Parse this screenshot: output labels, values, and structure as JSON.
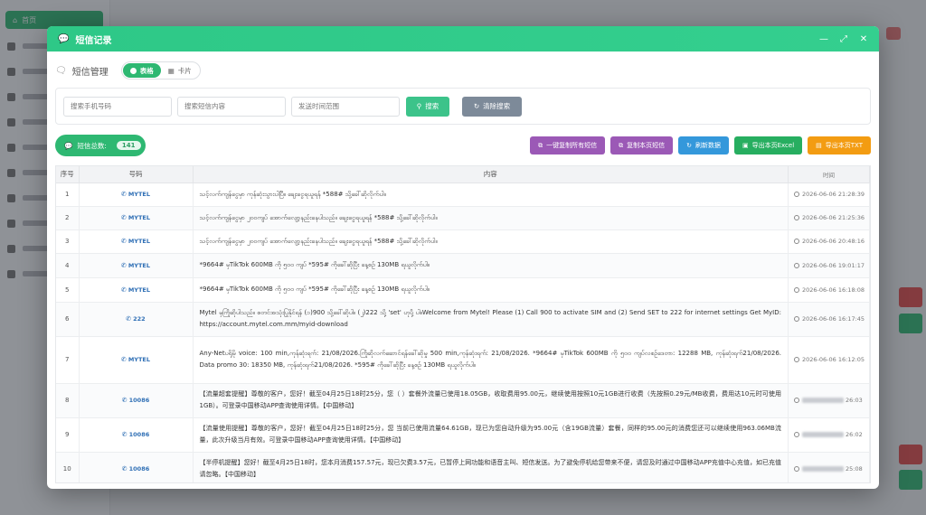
{
  "background": {
    "home_label": "首页"
  },
  "modal": {
    "title": "短信记录",
    "controls": [
      "—",
      "⤢",
      "✕"
    ],
    "subtitle": "短信管理",
    "view_table": "表格",
    "view_card": "卡片"
  },
  "search": {
    "phone_placeholder": "搜索手机号码",
    "content_placeholder": "搜索短信内容",
    "time_placeholder": "发送时间范围",
    "search_label": "搜索",
    "clear_label": "清除搜索"
  },
  "toolbar": {
    "total_label": "短信总数:",
    "total_count": "141",
    "copy_all_label": "一键复制所有短信",
    "copy_page_label": "复制本页短信",
    "refresh_label": "刷新数据",
    "export_excel_label": "导出本页Excel",
    "export_txt_label": "导出本页TXT"
  },
  "table": {
    "headers": [
      "序号",
      "号码",
      "内容",
      "时间"
    ],
    "rows": [
      {
        "idx": "1",
        "number": "MYTEL",
        "content": "သင့်လက်ကျန်ငွေမှာ ကုန်ဆုံးသွားပါပြီ။ ချေးငွေရယူရန် *588# သို့ခေါ်ဆိုလိုက်ပါ။",
        "time": "2026-06-06 21:28:39"
      },
      {
        "idx": "2",
        "number": "MYTEL",
        "content": "သင့်လက်ကျန်ငွေမှာ ၂၀၀ကျပ် အောက်လျော့နည်းနေပါသည်။ ချေးငွေရယူရန် *588# သို့ခေါ်ဆိုလိုက်ပါ။",
        "time": "2026-06-06 21:25:36"
      },
      {
        "idx": "3",
        "number": "MYTEL",
        "content": "သင့်လက်ကျန်ငွေမှာ ၂၀၀ကျပ် အောက်လျော့နည်းနေပါသည်။ ချေးငွေရယူရန် *588# သို့ခေါ်ဆိုလိုက်ပါ။",
        "time": "2026-06-06 20:48:16"
      },
      {
        "idx": "4",
        "number": "MYTEL",
        "content": "*9664# မှTikTok 600MB ကို ၅၀၀ ကျပ် *595# ကိုခေါ်ဆိုပြီး နေ့စဉ် 130MB ရယူလိုက်ပါ။",
        "time": "2026-06-06 19:01:17"
      },
      {
        "idx": "5",
        "number": "MYTEL",
        "content": "*9664# မှTikTok 600MB ကို ၅၀၀ ကျပ် *595# ကိုခေါ်ဆိုပြီး နေ့စဉ် 130MB ရယူလိုက်ပါ။",
        "time": "2026-06-06 16:18:08"
      },
      {
        "idx": "6",
        "number": "222",
        "content": "Mytel မှကြိုဆိုပါသည်။ စတင်အသုံးပြုနိုင်ရန် (၁)900 သို့ခေါ်ဆိုပါ။ (၂)222 သို့ 'set' ဟုပို့ ပါ။Welcome from Mytel! Please (1) Call 900 to activate SIM and (2) Send SET to 222 for internet settings Get MyID: https://account.mytel.com.mm/myid-download",
        "time": "2026-06-06 16:17:45"
      },
      {
        "idx": "7",
        "number": "MYTEL",
        "content": "Any-Netပရိုမို voice: 100 min,ကုန်ဆုံးရက်: 21/08/2026.ကြိုဆိုလက်ဆောင်ရန်ခေါ်ဆိုမှု 500 min,ကုန်ဆုံးရက်: 21/08/2026. *9664# မှTikTok 600MB ကို ၅၀၀ ကျပ်လစဉ်ဒေတာ: 12288 MB, ကုန်ဆုံးရက်21/08/2026. Data promo 30: 18350 MB, ကုန်ဆုံးရက်21/08/2026. *595# ကိုခေါ်ဆိုပြီး နေ့စဉ် 130MB ရယူလိုက်ပါ။",
        "time": "2026-06-06 16:12:05"
      },
      {
        "idx": "8",
        "number": "10086",
        "content": "【流量超套提醒】尊敬的客户，您好！截至04月25日18时25分，您（                  ）套餐外流量已使用18.05GB，收取费用95.00元，继续使用按照10元1GB进行收费（先按照0.29元/MB收费，费用达10元时可使用1GB）。可登录中国移动APP查询使用详情。【中国移动】",
        "time": "26:03"
      },
      {
        "idx": "9",
        "number": "10086",
        "content": "【流量使用提醒】尊敬的客户，您好！截至04月25日18时25分，您                  当前已使用流量64.61GB，现已为您自动升级为95.00元（含19GB流量）套餐，同样的95.00元的消费您还可以继续使用963.06MB流量，此次升级当月有效。可登录中国移动APP查询使用详情。【中国移动】",
        "time": "26:02"
      },
      {
        "idx": "10",
        "number": "10086",
        "content": "【半停机提醒】您好！截至4月25日18时，您本月消费157.57元，现已欠费3.57元，已暂停上网功能和语音主叫、短信发送。为了避免停机给您带来不便，请您及时通过中国移动APP充值中心充值，如已充值请忽略。【中国移动】",
        "time": "25:08"
      }
    ]
  }
}
